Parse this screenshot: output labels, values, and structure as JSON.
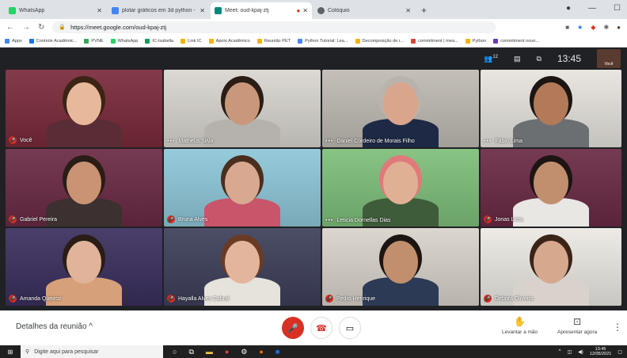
{
  "browser": {
    "tabs": [
      {
        "title": "WhatsApp",
        "color": "#25d366",
        "active": false
      },
      {
        "title": "plotar gráficos em 3d python - P",
        "color": "#4285f4",
        "active": false
      },
      {
        "title": "Meet: oud-kpaj-ztj",
        "color": "#00897b",
        "active": true
      },
      {
        "title": "Colóquio",
        "color": "#5f6368",
        "active": false
      }
    ],
    "url": "https://meet.google.com/oud-kpaj-ztj",
    "bookmarks": [
      {
        "label": "Apps",
        "color": "#4285f4"
      },
      {
        "label": "Controle Acadêmic...",
        "color": "#1a73e8"
      },
      {
        "label": "PVNE",
        "color": "#34a853"
      },
      {
        "label": "WhatsApp",
        "color": "#25d366"
      },
      {
        "label": "IC-Isabella",
        "color": "#0f9d58"
      },
      {
        "label": "Link IC",
        "color": "#f4b400"
      },
      {
        "label": "Apoio Acadêmico",
        "color": "#f4b400"
      },
      {
        "label": "Reunião PET",
        "color": "#f4b400"
      },
      {
        "label": "Python Tutorial: Lea...",
        "color": "#4285f4"
      },
      {
        "label": "Decomposição de r...",
        "color": "#f4b400"
      },
      {
        "label": "commitment | mea...",
        "color": "#db4437"
      },
      {
        "label": "Python",
        "color": "#f4b400"
      },
      {
        "label": "commitment noun...",
        "color": "#673ab7"
      }
    ]
  },
  "meet": {
    "participants_count": "12",
    "clock": "13:45",
    "self_label": "Você",
    "tiles": [
      {
        "name": "Você",
        "muted": true,
        "bg": "#7a2a3a",
        "skin": "#e8b89a",
        "hair": "#3b2416",
        "shirt": "#5a2d36"
      },
      {
        "name": "Matheus Silva",
        "muted": false,
        "bg": "#d9d6d0",
        "skin": "#c9987a",
        "hair": "#2a1d16",
        "shirt": "#b5b2ad"
      },
      {
        "name": "Daniel Cordeiro de Morais Filho",
        "muted": false,
        "bg": "#bfbab3",
        "skin": "#d9a58c",
        "hair": "#b8b3ad",
        "shirt": "#1e2a45"
      },
      {
        "name": "Fábio Lima",
        "muted": false,
        "bg": "#e7e4de",
        "skin": "#b27a58",
        "hair": "#1d1512",
        "shirt": "#6b6f72"
      },
      {
        "name": "Gabriel Pereira",
        "muted": true,
        "bg": "#6a2a44",
        "skin": "#c99374",
        "hair": "#2a1d16",
        "shirt": "#3c3030"
      },
      {
        "name": "Bruna Alves",
        "muted": true,
        "bg": "#8ec7d9",
        "skin": "#d9a890",
        "hair": "#4a2e1e",
        "shirt": "#c8556a"
      },
      {
        "name": "Letícia Dornellas Dias",
        "muted": false,
        "bg": "#7ebf7a",
        "skin": "#e0b095",
        "hair": "#e07a7a",
        "shirt": "#3e5c3a"
      },
      {
        "name": "Jonas Lima",
        "muted": true,
        "bg": "#6a2a44",
        "skin": "#c18f6e",
        "hair": "#1d1512",
        "shirt": "#e9e7e3"
      },
      {
        "name": "Amanda Queiroz",
        "muted": true,
        "bg": "#3a2f5e",
        "skin": "#e0b39a",
        "hair": "#2a1d16",
        "shirt": "#d6a07a"
      },
      {
        "name": "Hayalla Alves Cabral",
        "muted": true,
        "bg": "#3d3f5a",
        "skin": "#e2b59c",
        "hair": "#6a3b24",
        "shirt": "#e6e2dc"
      },
      {
        "name": "Pedro Henrique",
        "muted": true,
        "bg": "#d8d3cb",
        "skin": "#c18f6e",
        "hair": "#1d1512",
        "shirt": "#2c3a55"
      },
      {
        "name": "Débora Oliveira",
        "muted": true,
        "bg": "#ece9e4",
        "skin": "#d6a88e",
        "hair": "#3a2418",
        "shirt": "#d9d2cc"
      }
    ],
    "details_label": "Detalhes da reunião",
    "raise_hand_label": "Levantar a mão",
    "present_label": "Apresentar agora"
  },
  "taskbar": {
    "search_placeholder": "Digite aqui para pesquisar",
    "time": "13:45",
    "date": "12/05/2021"
  }
}
